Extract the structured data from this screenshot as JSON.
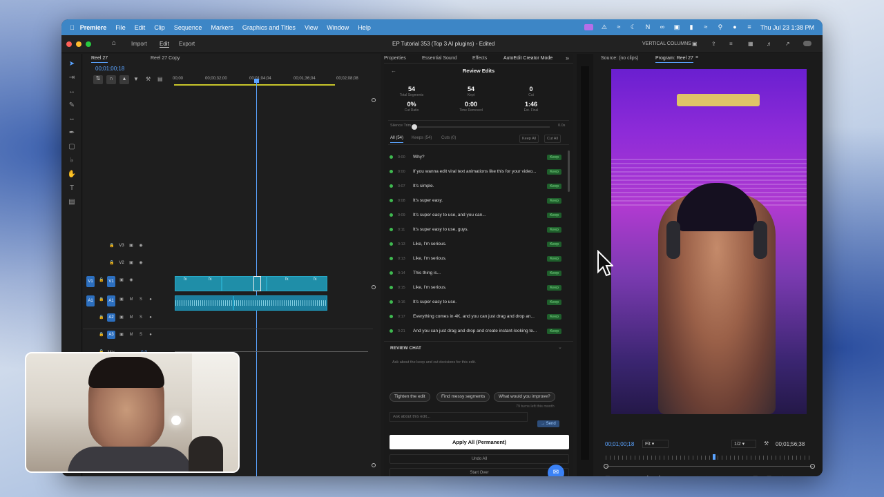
{
  "menubar": {
    "app": "Premiere",
    "items": [
      "File",
      "Edit",
      "Clip",
      "Sequence",
      "Markers",
      "Graphics and Titles",
      "View",
      "Window",
      "Help"
    ],
    "clock": "Thu Jul 23  1:38 PM"
  },
  "titlebar": {
    "tabs": [
      "Import",
      "Edit",
      "Export"
    ],
    "title": "EP Tutorial 353 (Top 3 AI plugins) - Edited",
    "workspace": "VERTICAL COLUMNS"
  },
  "timeline": {
    "tabs": [
      "Reel 27",
      "Reel 27 Copy"
    ],
    "timecode": "00;01;00;18",
    "ruler": [
      "00;00",
      "00;00;32;00",
      "00;01;04;04",
      "00;01;36;04",
      "00;02;08;08"
    ],
    "tracks": [
      {
        "name": "V3",
        "lead": ""
      },
      {
        "name": "V2",
        "lead": ""
      },
      {
        "name": "V1",
        "lead": "V1"
      },
      {
        "name": "A1",
        "lead": "A1"
      },
      {
        "name": "A2",
        "lead": ""
      },
      {
        "name": "A3",
        "lead": ""
      }
    ],
    "mix_label": "Mix",
    "mix_value": "0.0",
    "clip_fx": "fx"
  },
  "autoedit": {
    "tabs": [
      "Properties",
      "Essential Sound",
      "Effects",
      "AutoEdit Creator Mode"
    ],
    "heading": "Review Edits",
    "stats": [
      {
        "value": "54",
        "label": "Total Segments"
      },
      {
        "value": "54",
        "label": "Kept"
      },
      {
        "value": "0",
        "label": "Cut"
      },
      {
        "value": "0%",
        "label": "Cut Ratio"
      },
      {
        "value": "0:00",
        "label": "Time Removed"
      },
      {
        "value": "1:46",
        "label": "Est. Final"
      }
    ],
    "silence_label": "Silence Trim",
    "silence_value": "0.0s",
    "silence_level": 0,
    "filters": [
      "All (54)",
      "Keeps (54)",
      "Cuts (0)"
    ],
    "keep_all": "Keep All",
    "cut_all": "Cut All",
    "segments": [
      {
        "time": "0:00",
        "text": "Why?",
        "status": "Keep"
      },
      {
        "time": "0:00",
        "text": "If you wanna edit viral text animations like this for your video...",
        "status": "Keep"
      },
      {
        "time": "0:07",
        "text": "It's simple.",
        "status": "Keep"
      },
      {
        "time": "0:08",
        "text": "It's super easy.",
        "status": "Keep"
      },
      {
        "time": "0:09",
        "text": "It's super easy to use, and you can...",
        "status": "Keep"
      },
      {
        "time": "0:11",
        "text": "It's super easy to use, guys.",
        "status": "Keep"
      },
      {
        "time": "0:13",
        "text": "Like, I'm serious.",
        "status": "Keep"
      },
      {
        "time": "0:13",
        "text": "Like, I'm serious.",
        "status": "Keep"
      },
      {
        "time": "0:14",
        "text": "This thing is...",
        "status": "Keep"
      },
      {
        "time": "0:15",
        "text": "Like, I'm serious.",
        "status": "Keep"
      },
      {
        "time": "0:16",
        "text": "It's super easy to use.",
        "status": "Keep"
      },
      {
        "time": "0:17",
        "text": "Everything comes in 4K, and you can just drag and drop an...",
        "status": "Keep"
      },
      {
        "time": "0:21",
        "text": "And you can just drag and drop and create instant-looking te...",
        "status": "Keep"
      }
    ],
    "chat": {
      "title": "REVIEW CHAT",
      "hint": "Ask about the keep and cut decisions for this edit.",
      "chips": [
        "Tighten the edit",
        "Find messy segments",
        "What would you improve?"
      ],
      "turns": "79 turns left this month",
      "placeholder": "Ask about this edit...",
      "send": "Send"
    },
    "apply": "Apply All (Permanent)",
    "undo": "Undo All",
    "start_over": "Start Over"
  },
  "monitor": {
    "source_tab": "Source: (no clips)",
    "program_tab": "Program: Reel 27",
    "timecode": "00;01;00;18",
    "fit": "Fit",
    "res": "1/2",
    "duration": "00;01;56;38"
  }
}
